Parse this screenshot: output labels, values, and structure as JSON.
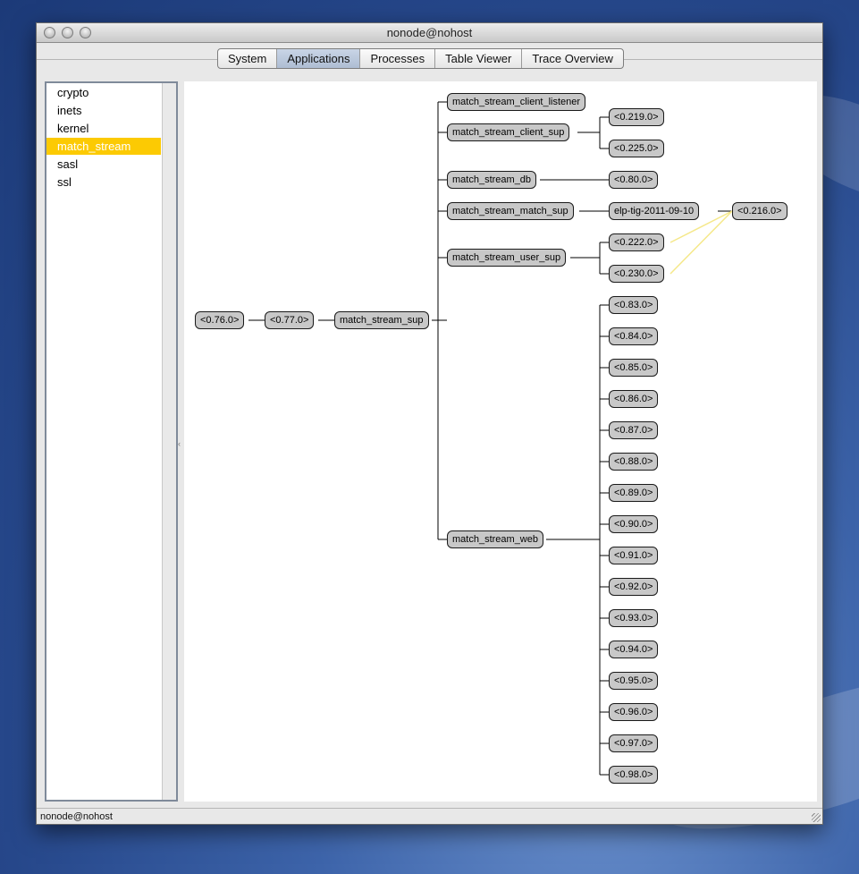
{
  "window": {
    "title": "nonode@nohost",
    "status": "nonode@nohost"
  },
  "tabs": [
    {
      "label": "System"
    },
    {
      "label": "Applications",
      "active": true
    },
    {
      "label": "Processes"
    },
    {
      "label": "Table Viewer"
    },
    {
      "label": "Trace Overview"
    }
  ],
  "apps": {
    "items": [
      "crypto",
      "inets",
      "kernel",
      "match_stream",
      "sasl",
      "ssl"
    ],
    "selected": "match_stream"
  },
  "tree": {
    "root": "<0.76.0>",
    "master": "<0.77.0>",
    "sup": "match_stream_sup",
    "children": {
      "client_listener": "match_stream_client_listener",
      "client_sup": "match_stream_client_sup",
      "db": "match_stream_db",
      "match_sup": "match_stream_match_sup",
      "user_sup": "match_stream_user_sup",
      "web": "match_stream_web"
    },
    "client_sup_children": [
      "<0.219.0>",
      "<0.225.0>"
    ],
    "db_child": "<0.80.0>",
    "match_sup_child": "elp-tig-2011-09-10",
    "match_child": "<0.216.0>",
    "user_sup_children": [
      "<0.222.0>",
      "<0.230.0>"
    ],
    "web_children": [
      "<0.83.0>",
      "<0.84.0>",
      "<0.85.0>",
      "<0.86.0>",
      "<0.87.0>",
      "<0.88.0>",
      "<0.89.0>",
      "<0.90.0>",
      "<0.91.0>",
      "<0.92.0>",
      "<0.93.0>",
      "<0.94.0>",
      "<0.95.0>",
      "<0.96.0>",
      "<0.97.0>",
      "<0.98.0>"
    ]
  },
  "colors": {
    "link_line": "#000000",
    "monitor_line": "#f5e88a",
    "selection": "#fcca03",
    "node_fill": "#c8c8c8"
  }
}
